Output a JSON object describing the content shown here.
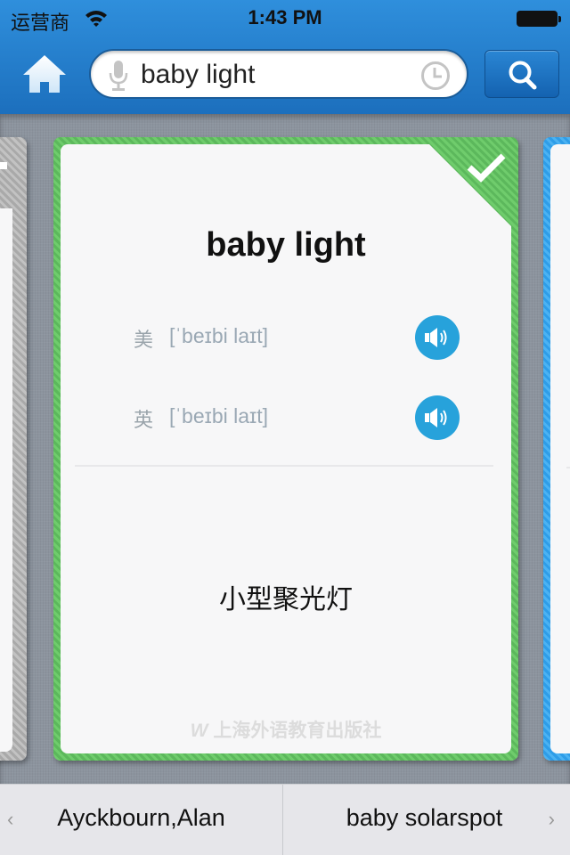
{
  "status_bar": {
    "carrier": "运营商",
    "time": "1:43 PM",
    "wifi_icon": "wifi-icon",
    "battery_icon": "battery-icon"
  },
  "header": {
    "home_icon": "home-icon",
    "search": {
      "value": "baby light",
      "mic_icon": "microphone-icon",
      "history_icon": "clock-icon"
    },
    "search_button_icon": "search-icon"
  },
  "card": {
    "word": "baby light",
    "status_icon": "checkmark-icon",
    "status_color": "#5cb85c",
    "pronunciations": [
      {
        "label": "美",
        "phonetic": "[ˈbeɪbi laɪt]",
        "icon": "speaker-icon"
      },
      {
        "label": "英",
        "phonetic": "[ˈbeɪbi laɪt]",
        "icon": "speaker-icon"
      }
    ],
    "meaning": "小型聚光灯",
    "publisher": "上海外语教育出版社",
    "publisher_logo": "W"
  },
  "side_cards": {
    "left_color": "#a9a9a9",
    "right_color": "#2e9de8"
  },
  "bottom_nav": {
    "prev_label": "Ayckbourn,Alan",
    "next_label": "baby solarspot",
    "prev_icon": "chevron-left-icon",
    "next_icon": "chevron-right-icon",
    "prev_glyph": "‹",
    "next_glyph": "›"
  }
}
